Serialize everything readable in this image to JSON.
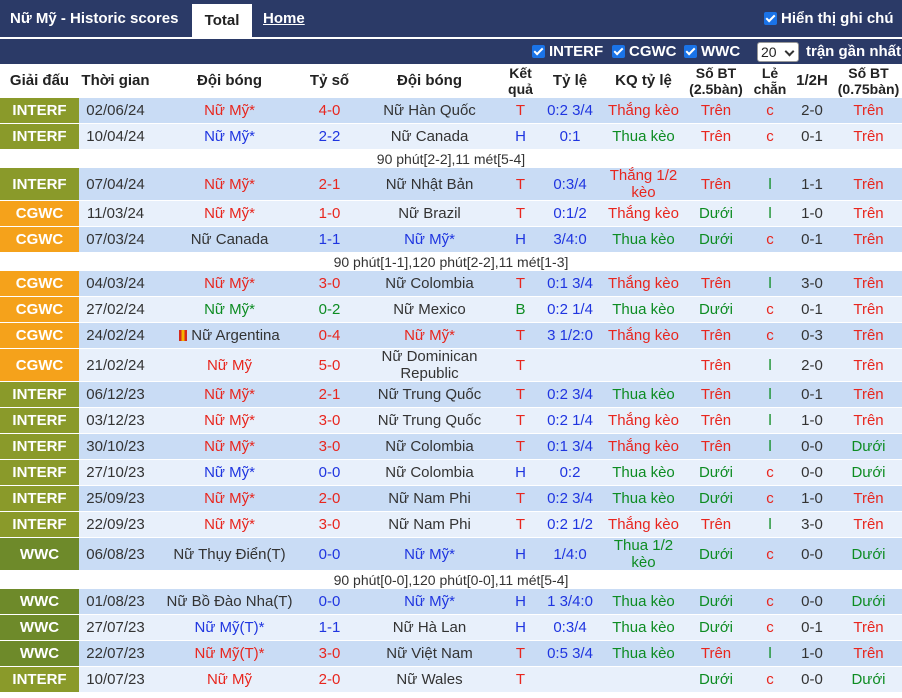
{
  "header": {
    "title": "Nữ Mỹ - Historic scores",
    "tab_total": "Total",
    "tab_home": "Home",
    "show_cn": "Hiển thị ghi chú"
  },
  "filters": {
    "items": [
      "INTERF",
      "CGWC",
      "WWC"
    ],
    "count_value": "20",
    "recent_label": "trận gần nhất"
  },
  "columns": [
    "Giải đấu",
    "Thời gian",
    "Đội bóng",
    "Tỷ số",
    "Đội bóng",
    "Kết quả",
    "Tỷ lệ",
    "KQ tỷ lệ",
    "Số BT (2.5bàn)",
    "Lẻ chẵn",
    "1/2H",
    "Số BT (0.75bàn)"
  ],
  "colors": {
    "INTERF": "#8a9a2a",
    "CGWC": "#f5a21b",
    "WWC": "#6e8a2a",
    "win": "#e8261e",
    "draw": "#1f35e0",
    "loss": "#0d8c22"
  },
  "rows": [
    {
      "type": "match",
      "league": "INTERF",
      "date": "02/06/24",
      "home": "Nữ Mỹ*",
      "home_c": "red",
      "score": "4-0",
      "score_c": "red",
      "away": "Nữ Hàn Quốc",
      "away_c": "dark",
      "res": "T",
      "res_c": "red",
      "odds": "0:2 3/4",
      "kq": "Thắng kèo",
      "kq_c": "red",
      "bt": "Trên",
      "bt_c": "red",
      "lc": "c",
      "lc_c": "red",
      "h1": "2-0",
      "bt2": "Trên",
      "bt2_c": "red",
      "shade": "dark",
      "h": 26
    },
    {
      "type": "match",
      "league": "INTERF",
      "date": "10/04/24",
      "home": "Nữ Mỹ*",
      "home_c": "blue",
      "score": "2-2",
      "score_c": "blue",
      "away": "Nữ Canada",
      "away_c": "dark",
      "res": "H",
      "res_c": "blue",
      "odds": "0:1",
      "kq": "Thua kèo",
      "kq_c": "green",
      "bt": "Trên",
      "bt_c": "red",
      "lc": "c",
      "lc_c": "red",
      "h1": "0-1",
      "bt2": "Trên",
      "bt2_c": "red",
      "shade": "light",
      "h": 26
    },
    {
      "type": "note",
      "text": "90 phút[2-2],11 mét[5-4]"
    },
    {
      "type": "match",
      "league": "INTERF",
      "date": "07/04/24",
      "home": "Nữ Mỹ*",
      "home_c": "red",
      "score": "2-1",
      "score_c": "red",
      "away": "Nữ Nhật Bản",
      "away_c": "dark",
      "res": "T",
      "res_c": "red",
      "odds": "0:3/4",
      "kq": "Thắng 1/2 kèo",
      "kq_c": "red",
      "bt": "Trên",
      "bt_c": "red",
      "lc": "l",
      "lc_c": "green",
      "h1": "1-1",
      "bt2": "Trên",
      "bt2_c": "red",
      "shade": "dark",
      "h": 33
    },
    {
      "type": "match",
      "league": "CGWC",
      "date": "11/03/24",
      "home": "Nữ Mỹ*",
      "home_c": "red",
      "score": "1-0",
      "score_c": "red",
      "away": "Nữ Brazil",
      "away_c": "dark",
      "res": "T",
      "res_c": "red",
      "odds": "0:1/2",
      "kq": "Thắng kèo",
      "kq_c": "red",
      "bt": "Dưới",
      "bt_c": "green",
      "lc": "l",
      "lc_c": "green",
      "h1": "1-0",
      "bt2": "Trên",
      "bt2_c": "red",
      "shade": "light",
      "h": 26
    },
    {
      "type": "match",
      "league": "CGWC",
      "date": "07/03/24",
      "home": "Nữ Canada",
      "home_c": "dark",
      "score": "1-1",
      "score_c": "blue",
      "away": "Nữ Mỹ*",
      "away_c": "blue",
      "res": "H",
      "res_c": "blue",
      "odds": "3/4:0",
      "kq": "Thua kèo",
      "kq_c": "green",
      "bt": "Dưới",
      "bt_c": "green",
      "lc": "c",
      "lc_c": "red",
      "h1": "0-1",
      "bt2": "Trên",
      "bt2_c": "red",
      "shade": "dark",
      "h": 26
    },
    {
      "type": "note",
      "text": "90 phút[1-1],120 phút[2-2],11 mét[1-3]"
    },
    {
      "type": "match",
      "league": "CGWC",
      "date": "04/03/24",
      "home": "Nữ Mỹ*",
      "home_c": "red",
      "score": "3-0",
      "score_c": "red",
      "away": "Nữ Colombia",
      "away_c": "dark",
      "res": "T",
      "res_c": "red",
      "odds": "0:1 3/4",
      "kq": "Thắng kèo",
      "kq_c": "red",
      "bt": "Trên",
      "bt_c": "red",
      "lc": "l",
      "lc_c": "green",
      "h1": "3-0",
      "bt2": "Trên",
      "bt2_c": "red",
      "shade": "dark",
      "h": 26
    },
    {
      "type": "match",
      "league": "CGWC",
      "date": "27/02/24",
      "home": "Nữ Mỹ*",
      "home_c": "green",
      "score": "0-2",
      "score_c": "green",
      "away": "Nữ Mexico",
      "away_c": "dark",
      "res": "B",
      "res_c": "green",
      "odds": "0:2 1/4",
      "kq": "Thua kèo",
      "kq_c": "green",
      "bt": "Dưới",
      "bt_c": "green",
      "lc": "c",
      "lc_c": "red",
      "h1": "0-1",
      "bt2": "Trên",
      "bt2_c": "red",
      "shade": "light",
      "h": 26
    },
    {
      "type": "match",
      "league": "CGWC",
      "date": "24/02/24",
      "home": "Nữ Argentina",
      "home_c": "dark",
      "flag": true,
      "score": "0-4",
      "score_c": "red",
      "away": "Nữ Mỹ*",
      "away_c": "red",
      "res": "T",
      "res_c": "red",
      "odds": "3 1/2:0",
      "kq": "Thắng kèo",
      "kq_c": "red",
      "bt": "Trên",
      "bt_c": "red",
      "lc": "c",
      "lc_c": "red",
      "h1": "0-3",
      "bt2": "Trên",
      "bt2_c": "red",
      "shade": "dark",
      "h": 26
    },
    {
      "type": "match",
      "league": "CGWC",
      "date": "21/02/24",
      "home": "Nữ Mỹ",
      "home_c": "red",
      "score": "5-0",
      "score_c": "red",
      "away": "Nữ Dominican Republic",
      "away_c": "dark",
      "res": "T",
      "res_c": "red",
      "odds": "",
      "kq": "",
      "kq_c": "red",
      "bt": "Trên",
      "bt_c": "red",
      "lc": "l",
      "lc_c": "green",
      "h1": "2-0",
      "bt2": "Trên",
      "bt2_c": "red",
      "shade": "light",
      "h": 33
    },
    {
      "type": "match",
      "league": "INTERF",
      "date": "06/12/23",
      "home": "Nữ Mỹ*",
      "home_c": "red",
      "score": "2-1",
      "score_c": "red",
      "away": "Nữ Trung Quốc",
      "away_c": "dark",
      "res": "T",
      "res_c": "red",
      "odds": "0:2 3/4",
      "kq": "Thua kèo",
      "kq_c": "green",
      "bt": "Trên",
      "bt_c": "red",
      "lc": "l",
      "lc_c": "green",
      "h1": "0-1",
      "bt2": "Trên",
      "bt2_c": "red",
      "shade": "dark",
      "h": 26
    },
    {
      "type": "match",
      "league": "INTERF",
      "date": "03/12/23",
      "home": "Nữ Mỹ*",
      "home_c": "red",
      "score": "3-0",
      "score_c": "red",
      "away": "Nữ Trung Quốc",
      "away_c": "dark",
      "res": "T",
      "res_c": "red",
      "odds": "0:2 1/4",
      "kq": "Thắng kèo",
      "kq_c": "red",
      "bt": "Trên",
      "bt_c": "red",
      "lc": "l",
      "lc_c": "green",
      "h1": "1-0",
      "bt2": "Trên",
      "bt2_c": "red",
      "shade": "light",
      "h": 26
    },
    {
      "type": "match",
      "league": "INTERF",
      "date": "30/10/23",
      "home": "Nữ Mỹ*",
      "home_c": "red",
      "score": "3-0",
      "score_c": "red",
      "away": "Nữ Colombia",
      "away_c": "dark",
      "res": "T",
      "res_c": "red",
      "odds": "0:1 3/4",
      "kq": "Thắng kèo",
      "kq_c": "red",
      "bt": "Trên",
      "bt_c": "red",
      "lc": "l",
      "lc_c": "green",
      "h1": "0-0",
      "bt2": "Dưới",
      "bt2_c": "green",
      "shade": "dark",
      "h": 26
    },
    {
      "type": "match",
      "league": "INTERF",
      "date": "27/10/23",
      "home": "Nữ Mỹ*",
      "home_c": "blue",
      "score": "0-0",
      "score_c": "blue",
      "away": "Nữ Colombia",
      "away_c": "dark",
      "res": "H",
      "res_c": "blue",
      "odds": "0:2",
      "kq": "Thua kèo",
      "kq_c": "green",
      "bt": "Dưới",
      "bt_c": "green",
      "lc": "c",
      "lc_c": "red",
      "h1": "0-0",
      "bt2": "Dưới",
      "bt2_c": "green",
      "shade": "light",
      "h": 26
    },
    {
      "type": "match",
      "league": "INTERF",
      "date": "25/09/23",
      "home": "Nữ Mỹ*",
      "home_c": "red",
      "score": "2-0",
      "score_c": "red",
      "away": "Nữ Nam Phi",
      "away_c": "dark",
      "res": "T",
      "res_c": "red",
      "odds": "0:2 3/4",
      "kq": "Thua kèo",
      "kq_c": "green",
      "bt": "Dưới",
      "bt_c": "green",
      "lc": "c",
      "lc_c": "red",
      "h1": "1-0",
      "bt2": "Trên",
      "bt2_c": "red",
      "shade": "dark",
      "h": 26
    },
    {
      "type": "match",
      "league": "INTERF",
      "date": "22/09/23",
      "home": "Nữ Mỹ*",
      "home_c": "red",
      "score": "3-0",
      "score_c": "red",
      "away": "Nữ Nam Phi",
      "away_c": "dark",
      "res": "T",
      "res_c": "red",
      "odds": "0:2 1/2",
      "kq": "Thắng kèo",
      "kq_c": "red",
      "bt": "Trên",
      "bt_c": "red",
      "lc": "l",
      "lc_c": "green",
      "h1": "3-0",
      "bt2": "Trên",
      "bt2_c": "red",
      "shade": "light",
      "h": 26
    },
    {
      "type": "match",
      "league": "WWC",
      "date": "06/08/23",
      "home": "Nữ Thụy Điển(T)",
      "home_c": "dark",
      "score": "0-0",
      "score_c": "blue",
      "away": "Nữ Mỹ*",
      "away_c": "blue",
      "res": "H",
      "res_c": "blue",
      "odds": "1/4:0",
      "kq": "Thua 1/2 kèo",
      "kq_c": "green",
      "bt": "Dưới",
      "bt_c": "green",
      "lc": "c",
      "lc_c": "red",
      "h1": "0-0",
      "bt2": "Dưới",
      "bt2_c": "green",
      "shade": "dark",
      "h": 33
    },
    {
      "type": "note",
      "text": "90 phút[0-0],120 phút[0-0],11 mét[5-4]"
    },
    {
      "type": "match",
      "league": "WWC",
      "date": "01/08/23",
      "home": "Nữ Bồ Đào Nha(T)",
      "home_c": "dark",
      "score": "0-0",
      "score_c": "blue",
      "away": "Nữ Mỹ*",
      "away_c": "blue",
      "res": "H",
      "res_c": "blue",
      "odds": "1 3/4:0",
      "kq": "Thua kèo",
      "kq_c": "green",
      "bt": "Dưới",
      "bt_c": "green",
      "lc": "c",
      "lc_c": "red",
      "h1": "0-0",
      "bt2": "Dưới",
      "bt2_c": "green",
      "shade": "dark",
      "h": 26
    },
    {
      "type": "match",
      "league": "WWC",
      "date": "27/07/23",
      "home": "Nữ Mỹ(T)*",
      "home_c": "blue",
      "score": "1-1",
      "score_c": "blue",
      "away": "Nữ Hà Lan",
      "away_c": "dark",
      "res": "H",
      "res_c": "blue",
      "odds": "0:3/4",
      "kq": "Thua kèo",
      "kq_c": "green",
      "bt": "Dưới",
      "bt_c": "green",
      "lc": "c",
      "lc_c": "red",
      "h1": "0-1",
      "bt2": "Trên",
      "bt2_c": "red",
      "shade": "light",
      "h": 26
    },
    {
      "type": "match",
      "league": "WWC",
      "date": "22/07/23",
      "home": "Nữ Mỹ(T)*",
      "home_c": "red",
      "score": "3-0",
      "score_c": "red",
      "away": "Nữ Việt Nam",
      "away_c": "dark",
      "res": "T",
      "res_c": "red",
      "odds": "0:5 3/4",
      "kq": "Thua kèo",
      "kq_c": "green",
      "bt": "Trên",
      "bt_c": "red",
      "lc": "l",
      "lc_c": "green",
      "h1": "1-0",
      "bt2": "Trên",
      "bt2_c": "red",
      "shade": "dark",
      "h": 26
    },
    {
      "type": "match",
      "league": "INTERF",
      "date": "10/07/23",
      "home": "Nữ Mỹ",
      "home_c": "red",
      "score": "2-0",
      "score_c": "red",
      "away": "Nữ Wales",
      "away_c": "dark",
      "res": "T",
      "res_c": "red",
      "odds": "",
      "kq": "",
      "kq_c": "red",
      "bt": "Dưới",
      "bt_c": "green",
      "lc": "c",
      "lc_c": "red",
      "h1": "0-0",
      "bt2": "Dưới",
      "bt2_c": "green",
      "shade": "light",
      "h": 26
    }
  ]
}
